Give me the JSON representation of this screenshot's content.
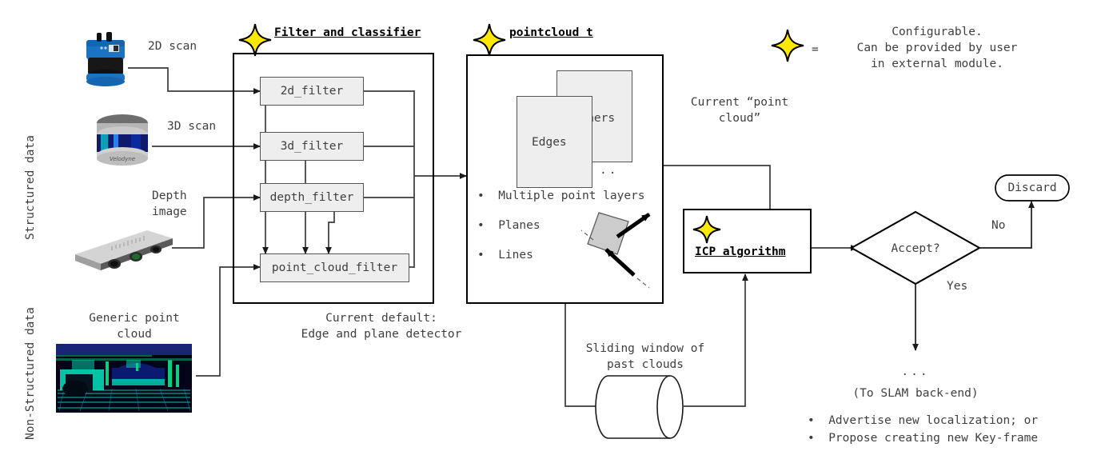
{
  "legend": {
    "equals": "=",
    "lines": [
      "Configurable.",
      "Can be provided by user",
      "in external module."
    ],
    "star_color": "#ffe800"
  },
  "side_labels": {
    "structured": "Structured data",
    "non_structured": "Non-Structured data"
  },
  "inputs": [
    {
      "label": "2D scan",
      "device": "sick-2d-lidar"
    },
    {
      "label": "3D scan",
      "device": "velodyne-3d-lidar"
    },
    {
      "label": "Depth\nimage",
      "device": "realsense-depth-camera"
    },
    {
      "label": "Generic point\ncloud",
      "device": "point-cloud-image"
    }
  ],
  "filter_block": {
    "title": "Filter and classifier",
    "filters": [
      "2d_filter",
      "3d_filter",
      "depth_filter",
      "point_cloud_filter"
    ],
    "caption": [
      "Current default:",
      "Edge and plane detector"
    ]
  },
  "pointcloud_block": {
    "title": "pointcloud t",
    "layers": [
      "Corners",
      "Edges"
    ],
    "ellipsis": "..",
    "bullets": [
      "Multiple point layers",
      "Planes",
      "Lines"
    ]
  },
  "icp_block": {
    "title": "ICP algorithm"
  },
  "edges": {
    "current_cloud": [
      "Current “point",
      "cloud”"
    ],
    "sliding_window": [
      "Sliding window of",
      "past clouds"
    ]
  },
  "decision": {
    "question": "Accept?",
    "no_label": "No",
    "yes_label": "Yes",
    "discard": "Discard"
  },
  "output": {
    "dots": "...",
    "to_slam": "(To SLAM back-end)",
    "bullets": [
      "Advertise new localization; or",
      "Propose creating new Key-frame"
    ]
  }
}
